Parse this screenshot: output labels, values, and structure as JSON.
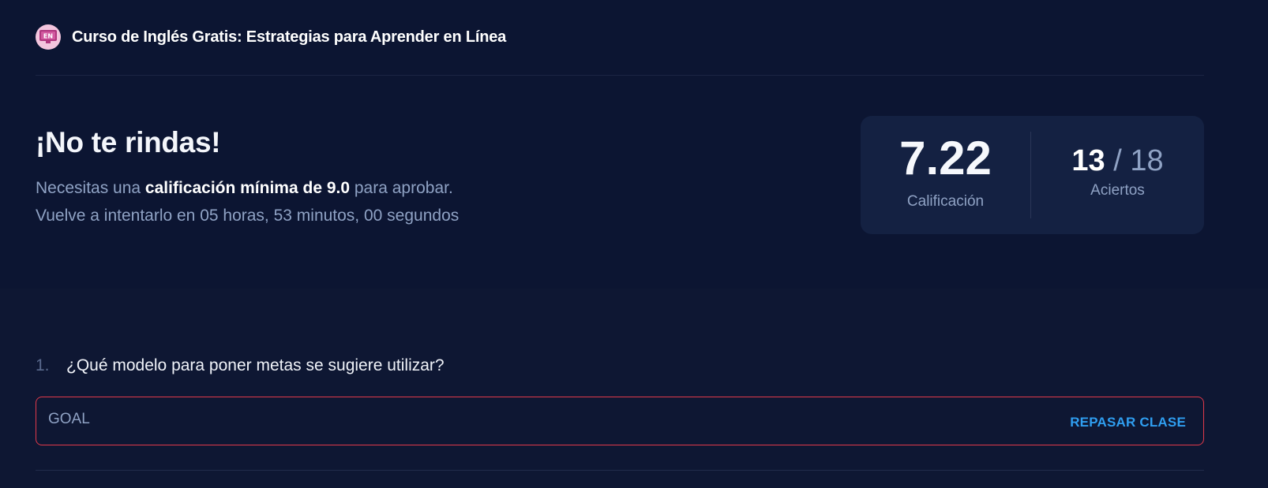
{
  "header": {
    "icon": "english-course-icon",
    "icon_text": "EN",
    "title": "Curso de Inglés Gratis: Estrategias para Aprender en Línea"
  },
  "result": {
    "title": "¡No te rindas!",
    "line1_prefix": "Necesitas una ",
    "line1_bold": "calificación mínima de 9.0",
    "line1_suffix": " para aprobar.",
    "line2": "Vuelve a intentarlo en 05 horas, 53 minutos, 00 segundos"
  },
  "score": {
    "grade_value": "7.22",
    "grade_label": "Calificación",
    "correct": "13",
    "slash": " / ",
    "total": "18",
    "hits_label": "Aciertos"
  },
  "questions": [
    {
      "number": "1.",
      "text": "¿Qué modelo para poner metas se sugiere utilizar?",
      "answer": "GOAL",
      "review_label": "REPASAR CLASE",
      "status": "incorrect"
    }
  ],
  "colors": {
    "background": "#0c1532",
    "accent": "#2f9ef0",
    "error_border": "#e0394a"
  }
}
